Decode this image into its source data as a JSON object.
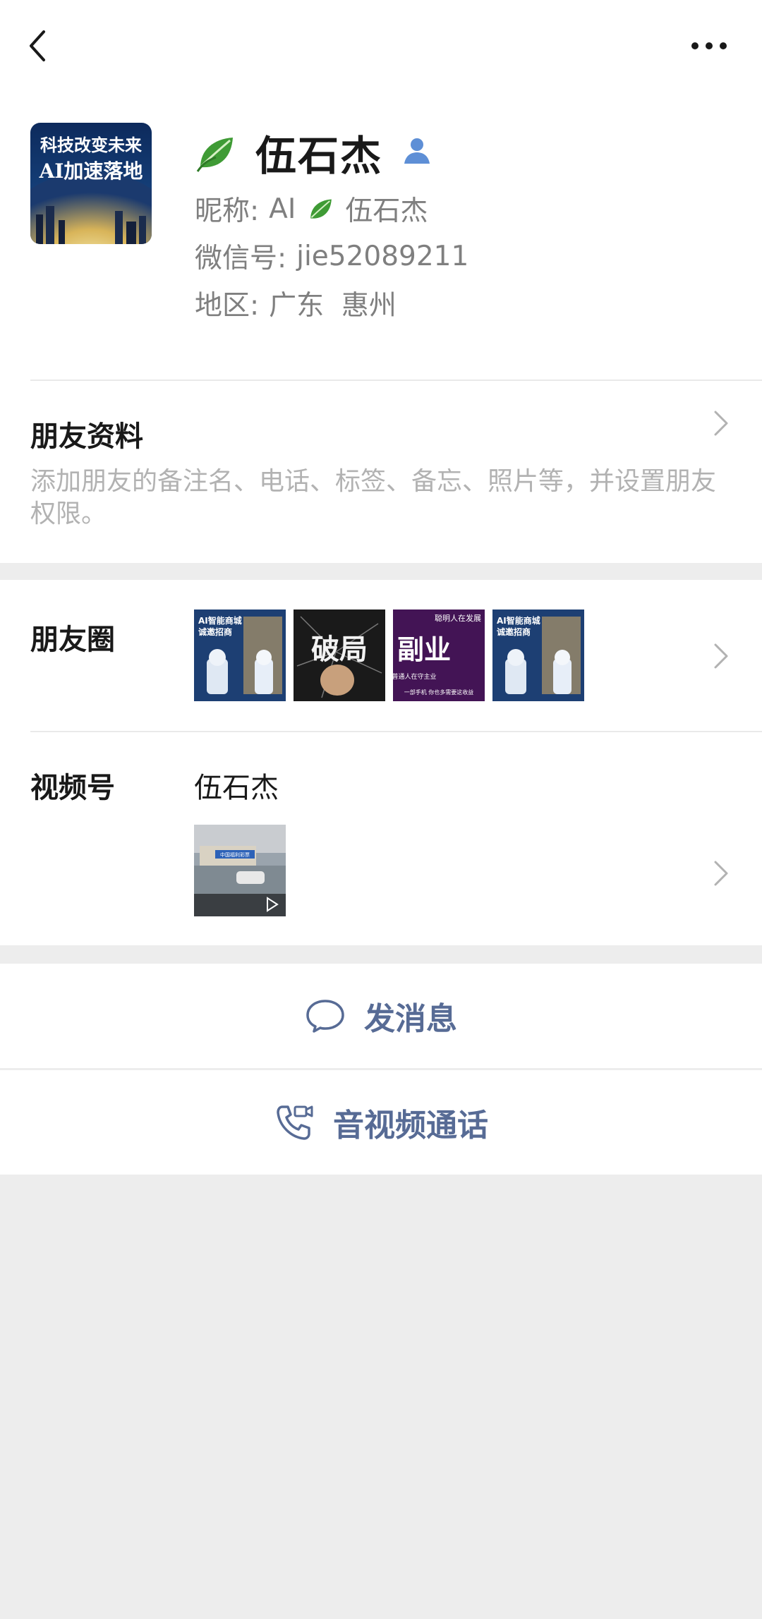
{
  "nav": {
    "back_icon": "chevron-left-icon",
    "more_icon": "more-dots-icon"
  },
  "profile": {
    "avatar_text_line1": "科技改变未来",
    "avatar_text_line2": "AI加速落地",
    "name": "伍石杰",
    "nickname_label": "昵称:",
    "nickname_prefix": "AI",
    "nickname_suffix": "伍石杰",
    "wechat_id_label": "微信号:",
    "wechat_id": "jie52089211",
    "region_label": "地区:",
    "region": "广东  惠州"
  },
  "friend_info": {
    "title": "朋友资料",
    "description": "添加朋友的备注名、电话、标签、备忘、照片等，并设置朋友权限。"
  },
  "moments": {
    "title": "朋友圈",
    "thumbs": [
      {
        "line1": "AI智能商城",
        "line2": "诚邀招商"
      },
      {
        "line1": "破局"
      },
      {
        "line1": "副业",
        "line2": "聪明人在发展",
        "line3": "普通人在守主业",
        "line4": "一部手机  你也多需要这收益"
      },
      {
        "line1": "AI智能商城",
        "line2": "诚邀招商"
      }
    ]
  },
  "channels": {
    "title": "视频号",
    "name": "伍石杰",
    "video_sign": "中国福利彩票"
  },
  "actions": {
    "message": "发消息",
    "call": "音视频通话"
  },
  "colors": {
    "link_blue": "#576b95",
    "gray_text": "#7f7f7f",
    "desc_text": "#b2b2b2",
    "background": "#ededed"
  }
}
